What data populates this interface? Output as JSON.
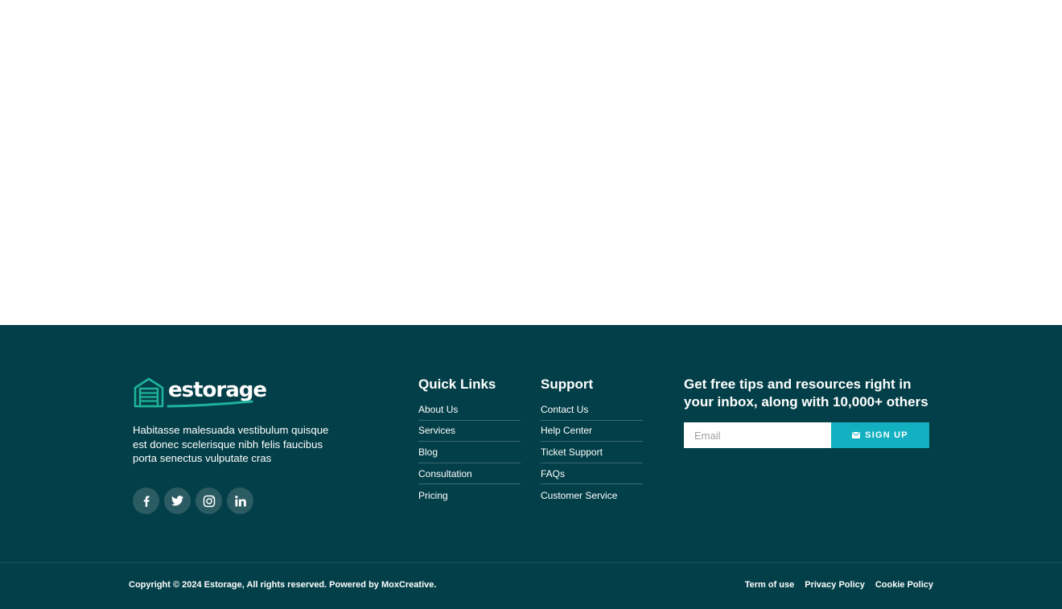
{
  "brand": {
    "name": "estorage",
    "description": "Habitasse malesuada vestibulum quisque est donec scelerisque nibh felis faucibus porta senectus vulputate cras",
    "accent_color": "#1fb39a"
  },
  "social": [
    {
      "icon": "facebook-icon"
    },
    {
      "icon": "twitter-icon"
    },
    {
      "icon": "instagram-icon"
    },
    {
      "icon": "linkedin-icon"
    }
  ],
  "quick_links": {
    "title": "Quick Links",
    "items": [
      "About Us",
      "Services",
      "Blog",
      "Consultation",
      "Pricing"
    ]
  },
  "support": {
    "title": "Support",
    "items": [
      "Contact Us",
      "Help Center",
      "Ticket Support",
      "FAQs",
      "Customer Service"
    ]
  },
  "newsletter": {
    "title": "Get free tips and resources right in your inbox, along with 10,000+ others",
    "email_placeholder": "Email",
    "email_value": "",
    "button_label": "SIGN UP",
    "button_icon": "envelope-icon",
    "button_color": "#13b0c2"
  },
  "footer_bottom": {
    "copyright": "Copyright © 2024 Estorage, All rights reserved. Powered by MoxCreative.",
    "links": [
      "Term of use",
      "Privacy Policy",
      "Cookie Policy"
    ]
  },
  "colors": {
    "footer_bg": "#033f48",
    "social_bg": "#2c5c63",
    "text": "#ffffff"
  }
}
